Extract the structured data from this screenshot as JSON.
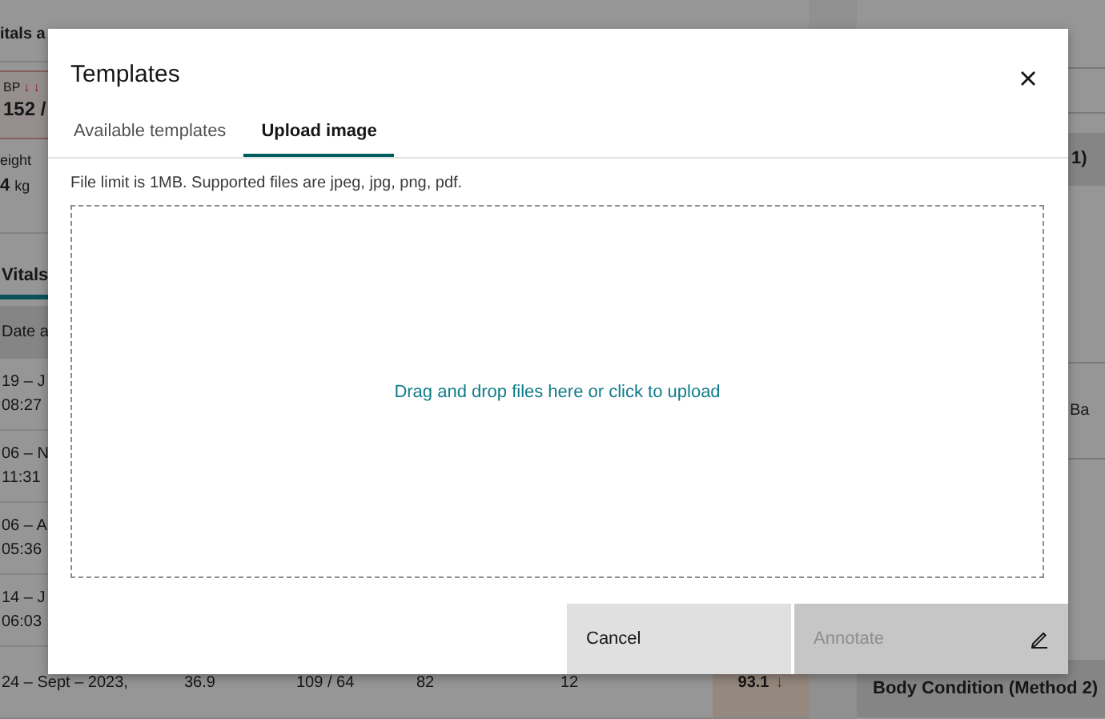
{
  "background": {
    "page_title": "itals a",
    "bp": {
      "label": "BP",
      "trend": "↓ ↓",
      "value": "152 /"
    },
    "weight": {
      "label": "eight",
      "value": "4",
      "unit": "kg"
    },
    "tabs": [
      {
        "label": "Vitals",
        "selected": true
      }
    ],
    "table": {
      "columns": [
        "Date a"
      ],
      "rows": [
        {
          "date_line_1": "19 – J",
          "date_line_2": "08:27",
          "cells": []
        },
        {
          "date_line_1": "06 – N",
          "date_line_2": "11:31",
          "cells": []
        },
        {
          "date_line_1": "06 – A",
          "date_line_2": "05:36",
          "cells": []
        },
        {
          "date_line_1": "14 – J",
          "date_line_2": "06:03",
          "cells": []
        },
        {
          "date_line_1": "24 – Sept – 2023,",
          "cells": [
            {
              "text": "36.9",
              "abnormal": false
            },
            {
              "text": "109 / 64",
              "abnormal": false
            },
            {
              "text": "82",
              "abnormal": false
            },
            {
              "text": "12",
              "abnormal": false
            },
            {
              "text": "93.1",
              "trend": "↓",
              "abnormal": true
            }
          ]
        }
      ]
    },
    "side_panel": {
      "section_heading": "1)",
      "label": "Ba",
      "footer_heading": "Body Condition (Method 2)"
    }
  },
  "dialog": {
    "title": "Templates",
    "tabs": [
      {
        "label": "Available templates",
        "selected": false
      },
      {
        "label": "Upload image",
        "selected": true
      }
    ],
    "hint": "File limit is 1MB. Supported files are jpeg, jpg, png, pdf.",
    "dropzone_text": "Drag and drop files here or click to upload",
    "buttons": [
      {
        "label": "Cancel",
        "kind": "secondary",
        "disabled": false
      },
      {
        "label": "Annotate",
        "kind": "primary",
        "disabled": true
      }
    ]
  }
}
